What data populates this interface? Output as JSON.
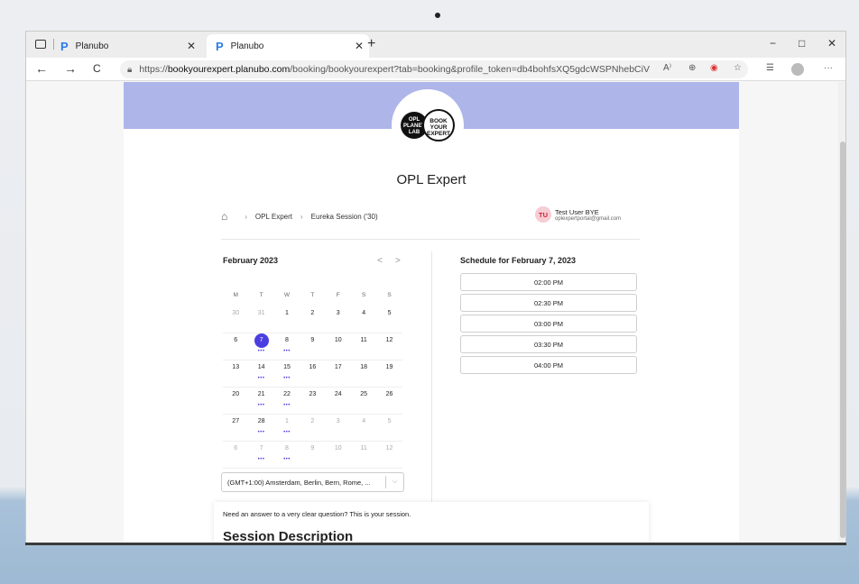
{
  "browser": {
    "tabs": [
      {
        "label": "Planubo",
        "active": false
      },
      {
        "label": "Planubo",
        "active": true
      }
    ],
    "new_tab": "+",
    "window_controls": {
      "minimize": "−",
      "maximize": "□",
      "close": "✕"
    },
    "nav": {
      "back": "←",
      "forward": "→",
      "reload": "C"
    },
    "url_prefix": "https://",
    "url_host": "bookyourexpert.planubo.com",
    "url_path": "/booking/bookyourexpert?tab=booking&profile_token=db4bohfsXQ5gdcWSPNhebCiV",
    "icons": [
      "read-aloud-icon",
      "zoom-icon",
      "extension-icon",
      "favorite-add-icon",
      "favorites-icon",
      "profile-icon",
      "more-icon"
    ],
    "read_aloud": "A⁾",
    "more": "···"
  },
  "logo": {
    "left_text": "OPL PLANET LAB",
    "right_text": "BOOK YOUR EXPERT"
  },
  "page": {
    "title": "OPL Expert",
    "breadcrumb": [
      "OPL Expert",
      "Eureka Session ('30)"
    ],
    "user": {
      "initials": "TU",
      "name": "Test User BYE",
      "email": "oplexpertportal@gmail.com"
    }
  },
  "calendar": {
    "month": "February 2023",
    "prev": "<",
    "next": ">",
    "weekdays": [
      "M",
      "T",
      "W",
      "T",
      "F",
      "S",
      "S"
    ],
    "weeks": [
      [
        {
          "d": "30",
          "m": true
        },
        {
          "d": "31",
          "m": true
        },
        {
          "d": "1"
        },
        {
          "d": "2"
        },
        {
          "d": "3"
        },
        {
          "d": "4"
        },
        {
          "d": "5"
        }
      ],
      [
        {
          "d": "6"
        },
        {
          "d": "7",
          "sel": true,
          "dots": true
        },
        {
          "d": "8",
          "dots": true
        },
        {
          "d": "9"
        },
        {
          "d": "10"
        },
        {
          "d": "11"
        },
        {
          "d": "12"
        }
      ],
      [
        {
          "d": "13"
        },
        {
          "d": "14",
          "dots": true
        },
        {
          "d": "15",
          "dots": true
        },
        {
          "d": "16"
        },
        {
          "d": "17"
        },
        {
          "d": "18"
        },
        {
          "d": "19"
        }
      ],
      [
        {
          "d": "20"
        },
        {
          "d": "21",
          "dots": true
        },
        {
          "d": "22",
          "dots": true
        },
        {
          "d": "23"
        },
        {
          "d": "24"
        },
        {
          "d": "25"
        },
        {
          "d": "26"
        }
      ],
      [
        {
          "d": "27"
        },
        {
          "d": "28",
          "dots": true
        },
        {
          "d": "1",
          "m": true,
          "dots": true
        },
        {
          "d": "2",
          "m": true
        },
        {
          "d": "3",
          "m": true
        },
        {
          "d": "4",
          "m": true
        },
        {
          "d": "5",
          "m": true
        }
      ],
      [
        {
          "d": "6",
          "m": true
        },
        {
          "d": "7",
          "m": true,
          "dots": true
        },
        {
          "d": "8",
          "m": true,
          "dots": true
        },
        {
          "d": "9",
          "m": true
        },
        {
          "d": "10",
          "m": true
        },
        {
          "d": "11",
          "m": true
        },
        {
          "d": "12",
          "m": true
        }
      ]
    ],
    "dots_glyph": "•••",
    "accent_color": "#4b3ee0",
    "timezone": "(GMT+1:00) Amsterdam, Berlin, Bern, Rome, ..."
  },
  "schedule": {
    "title": "Schedule for February 7, 2023",
    "slots": [
      "02:00 PM",
      "02:30 PM",
      "03:00 PM",
      "03:30 PM",
      "04:00 PM"
    ]
  },
  "description": {
    "question": "Need an answer to a very clear question? This is your session.",
    "heading": "Session Description"
  }
}
